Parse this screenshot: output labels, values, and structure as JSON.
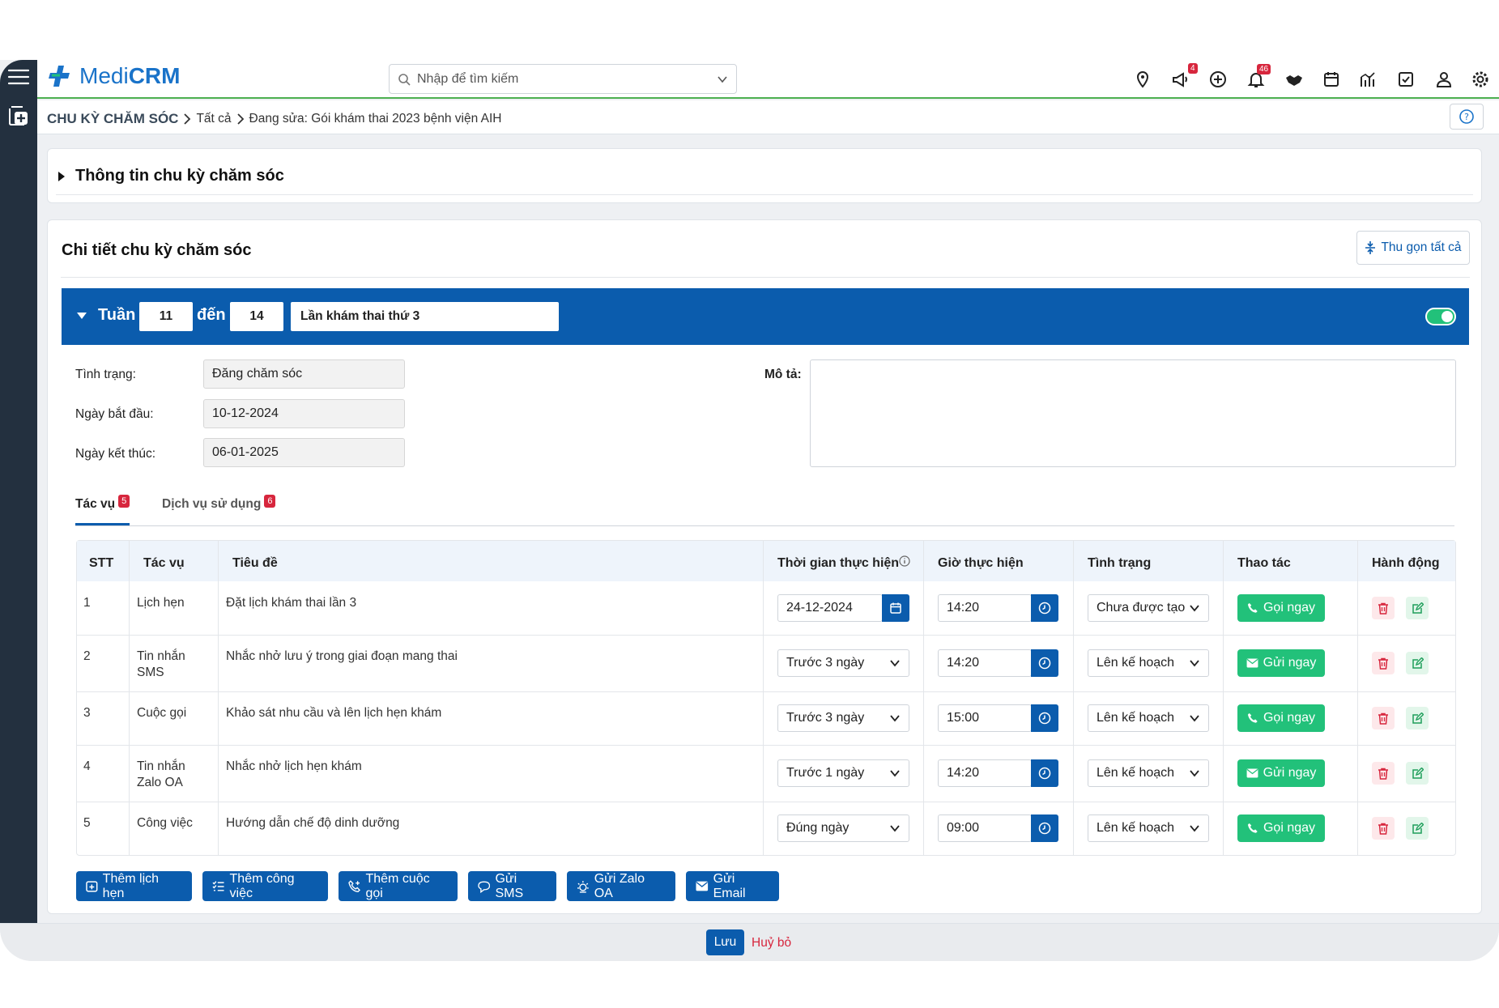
{
  "app": {
    "logo_prefix": "Medi",
    "logo_suffix": "CRM",
    "search_placeholder": "Nhập để tìm kiếm",
    "badges": {
      "announce": "4",
      "bell": "46"
    }
  },
  "breadcrumb": {
    "root": "CHU KỲ CHĂM SÓC",
    "level1": "Tất cả",
    "current": "Đang sửa: Gói khám thai 2023 bệnh viện AIH"
  },
  "info_section": {
    "title": "Thông tin chu kỳ chăm sóc"
  },
  "detail_section": {
    "title": "Chi tiết chu kỳ chăm sóc",
    "collapse_all": "Thu gọn tất cả"
  },
  "week_block": {
    "week_label": "Tuần",
    "week_from": "11",
    "to_label": "đến",
    "week_to": "14",
    "name": "Lần khám thai thứ 3",
    "toggle_on": true,
    "status_label": "Tình trạng:",
    "status_value": "Đăng chăm sóc",
    "start_label": "Ngày bắt đầu:",
    "start_value": "10-12-2024",
    "end_label": "Ngày kết thúc:",
    "end_value": "06-01-2025",
    "desc_label": "Mô tả:"
  },
  "tabs": [
    {
      "label": "Tác vụ",
      "count": "5"
    },
    {
      "label": "Dịch vụ sử dụng",
      "count": "6"
    }
  ],
  "table": {
    "headers": [
      "STT",
      "Tác vụ",
      "Tiêu đề",
      "Thời gian thực hiện",
      "Giờ thực hiện",
      "Tình trạng",
      "Thao tác",
      "Hành động"
    ],
    "rows": [
      {
        "stt": "1",
        "task": "Lịch hẹn",
        "task2": "",
        "title": "Đặt lịch khám thai lần 3",
        "when": "24-12-2024",
        "when_type": "date",
        "time": "14:20",
        "status": "Chưa được tạo",
        "action": "Gọi ngay",
        "action_icon": "phone"
      },
      {
        "stt": "2",
        "task": "Tin nhắn",
        "task2": "SMS",
        "title": "Nhắc nhở lưu ý trong giai đoạn mang thai",
        "when": "Trước 3 ngày",
        "when_type": "select",
        "time": "14:20",
        "status": "Lên kế hoạch",
        "action": "Gửi ngay",
        "action_icon": "mail"
      },
      {
        "stt": "3",
        "task": "Cuộc gọi",
        "task2": "",
        "title": "Khảo sát nhu cầu và lên lịch hẹn khám",
        "when": "Trước 3 ngày",
        "when_type": "select",
        "time": "15:00",
        "status": "Lên kế hoạch",
        "action": "Gọi ngay",
        "action_icon": "phone"
      },
      {
        "stt": "4",
        "task": "Tin nhắn",
        "task2": "Zalo OA",
        "title": "Nhắc nhở lịch hẹn khám",
        "when": "Trước 1 ngày",
        "when_type": "select",
        "time": "14:20",
        "status": "Lên kế hoạch",
        "action": "Gửi ngay",
        "action_icon": "mail"
      },
      {
        "stt": "5",
        "task": "Công việc",
        "task2": "",
        "title": "Hướng dẫn chế độ dinh dưỡng",
        "when": "Đúng ngày",
        "when_type": "select",
        "time": "09:00",
        "status": "Lên kế hoạch",
        "action": "Gọi ngay",
        "action_icon": "phone"
      }
    ]
  },
  "bottom_buttons": [
    "Thêm lịch hẹn",
    "Thêm công việc",
    "Thêm cuộc gọi",
    "Gửi SMS",
    "Gửi Zalo OA",
    "Gửi Email"
  ],
  "footer": {
    "save": "Lưu",
    "cancel": "Huỷ bỏ"
  },
  "colors": {
    "primary": "#0b5cad",
    "green": "#22c17a",
    "danger": "#d7263d",
    "sidebar": "#23303f"
  }
}
